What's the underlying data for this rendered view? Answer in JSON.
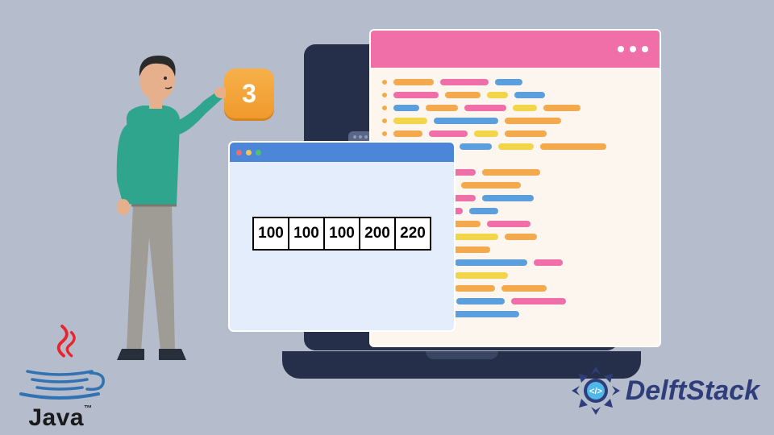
{
  "badge": {
    "value": "3"
  },
  "array": {
    "cells": [
      "100",
      "100",
      "100",
      "200",
      "220"
    ]
  },
  "logos": {
    "java": "Java",
    "java_tm": "™",
    "delft": "DelftStack"
  },
  "colors": {
    "background": "#b5bdcd",
    "laptop": "#262f4a",
    "code_header": "#f06fa9",
    "array_window": "#e4edfc",
    "array_header": "#4c86d8",
    "badge": "#f7a93a",
    "person_shirt": "#2ea58c",
    "person_pants": "#9e9c94",
    "java_red": "#e8242f",
    "java_blue": "#3172b1",
    "delft_blue": "#2f3e7a"
  }
}
